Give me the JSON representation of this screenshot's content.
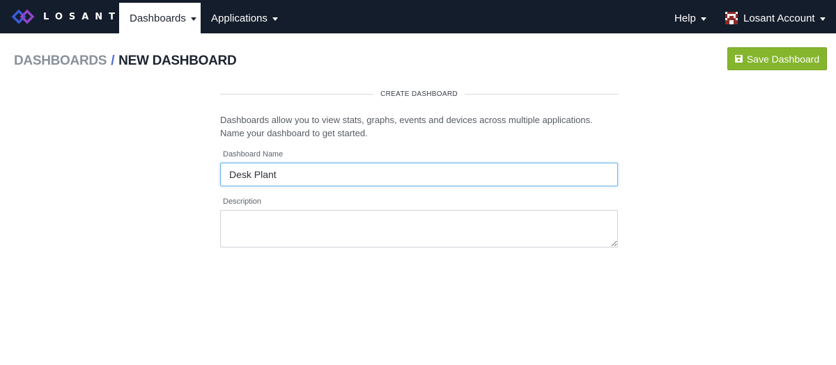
{
  "brand": {
    "logo_icon": "losant-diamond-logo",
    "name": "LOSANT",
    "colors": {
      "blue": "#3a5bd9",
      "purple": "#8e44c9"
    }
  },
  "nav": {
    "dashboards": "Dashboards",
    "applications": "Applications",
    "help": "Help",
    "account": "Losant Account",
    "avatar_icon": "pixel-avatar"
  },
  "header": {
    "breadcrumb_parent": "DASHBOARDS",
    "breadcrumb_separator": "/",
    "breadcrumb_current": "NEW DASHBOARD",
    "save_button": "Save Dashboard",
    "save_icon": "floppy-disk-icon",
    "save_color": "#84b52c"
  },
  "form": {
    "heading": "CREATE DASHBOARD",
    "intro_line1": "Dashboards allow you to view stats, graphs, events and devices across multiple applications.",
    "intro_line2": "Name your dashboard to get started.",
    "name_label": "Dashboard Name",
    "name_value": "Desk Plant",
    "description_label": "Description",
    "description_value": ""
  },
  "colors": {
    "navbar": "#141d2b",
    "focus": "#6cb5e8"
  }
}
